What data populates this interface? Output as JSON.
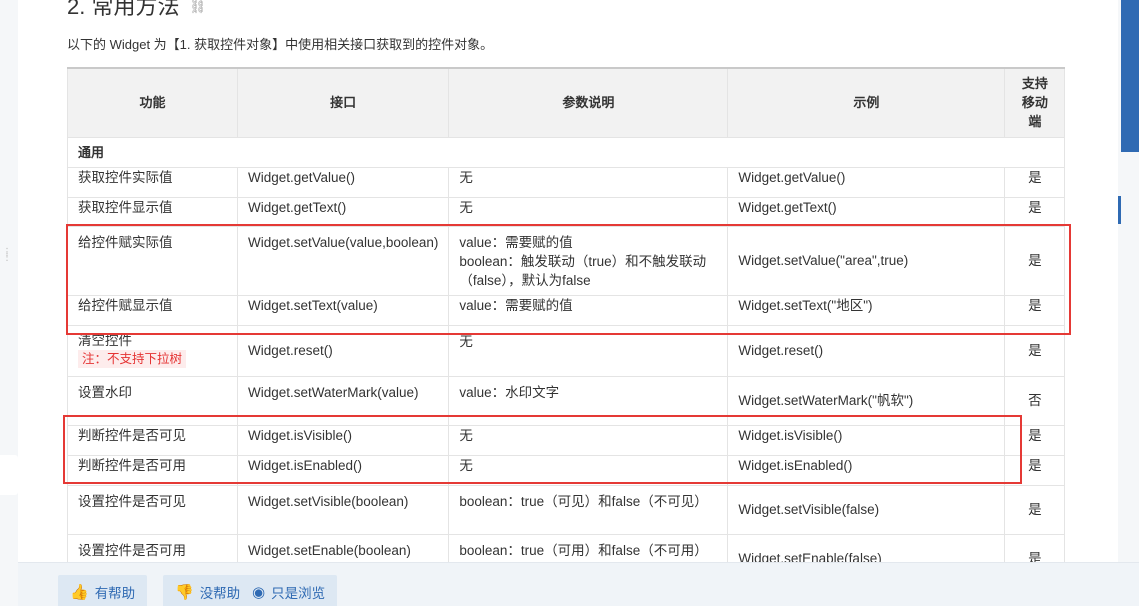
{
  "heading": "2. 常用方法",
  "link_icon": "🔗",
  "intro": "以下的 Widget 为【1. 获取控件对象】中使用相关接口获取到的控件对象。",
  "table": {
    "headers": [
      "功能",
      "接口",
      "参数说明",
      "示例",
      "支持移动端"
    ],
    "section": "通用",
    "rows": [
      {
        "func": "获取控件实际值",
        "api": "Widget.getValue()",
        "param": "无",
        "example": "Widget.getValue()",
        "mobile": "是"
      },
      {
        "func": "获取控件显示值",
        "api": "Widget.getText()",
        "param": "无",
        "example": "Widget.getText()",
        "mobile": "是"
      },
      {
        "func": "给控件赋实际值",
        "api": "Widget.setValue(value,boolean)",
        "param": "value：需要赋的值\nboolean：触发联动（true）和不触发联动（false），默认为false",
        "example": "Widget.setValue(\"area\",true)",
        "mobile": "是"
      },
      {
        "func": "给控件赋显示值",
        "api": "Widget.setText(value)",
        "param": "value：需要赋的值",
        "example": "Widget.setText(\"地区\")",
        "mobile": "是"
      },
      {
        "func": "清空控件",
        "note": "注：不支持下拉树",
        "api": "Widget.reset()",
        "param": "无",
        "example": "Widget.reset()",
        "mobile": "是"
      },
      {
        "func": "设置水印",
        "api": "Widget.setWaterMark(value)",
        "param": "value：水印文字",
        "example": "Widget.setWaterMark(\"帆软\")",
        "mobile": "否"
      },
      {
        "func": "判断控件是否可见",
        "api": "Widget.isVisible()",
        "param": "无",
        "example": "Widget.isVisible()",
        "mobile": "是"
      },
      {
        "func": "判断控件是否可用",
        "api": "Widget.isEnabled()",
        "param": "无",
        "example": "Widget.isEnabled()",
        "mobile": "是"
      },
      {
        "func": "设置控件是否可见",
        "api": "Widget.setVisible(boolean)",
        "param": "boolean：true（可见）和false（不可见）",
        "example": "Widget.setVisible(false)",
        "mobile": "是"
      },
      {
        "func": "设置控件是否可用",
        "api": "Widget.setEnable(boolean)",
        "param": "boolean：true（可用）和false（不可用）",
        "example": "Widget.setEnable(false)",
        "mobile": "是"
      }
    ]
  },
  "footer": {
    "helpful": "有帮助",
    "not_helpful": "没帮助",
    "just_browsing": "只是浏览",
    "icons": {
      "helpful": "thumbs-up-icon",
      "not_helpful": "thumbs-down-icon",
      "just_browsing": "eye-icon"
    }
  },
  "colors": {
    "highlight": "#e53935",
    "accent": "#2f6ab3",
    "note": "#e53333"
  }
}
